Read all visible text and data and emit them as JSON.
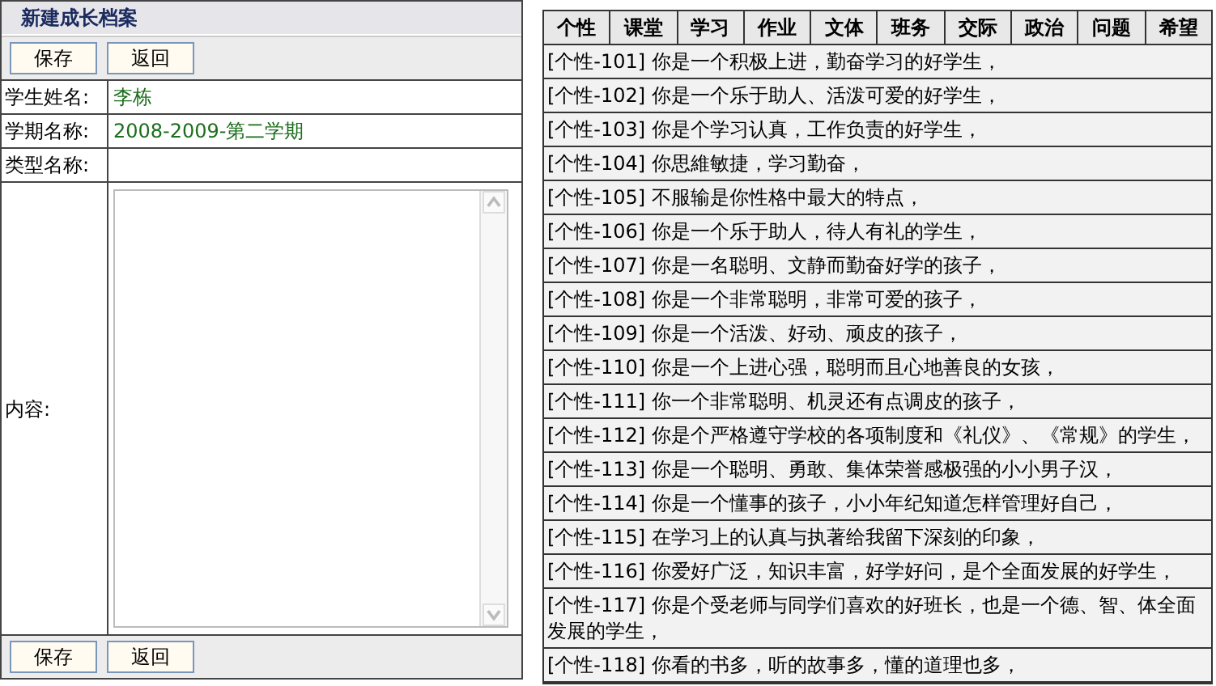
{
  "form": {
    "title": "新建成长档案",
    "top_buttons": [
      "保存",
      "返回"
    ],
    "fields": [
      {
        "label": "学生姓名:",
        "value": "李栋"
      },
      {
        "label": "学期名称:",
        "value": "2008-2009-第二学期"
      },
      {
        "label": "类型名称:"
      }
    ],
    "content_label": "内容:",
    "bottom_buttons": [
      "保存",
      "返回"
    ]
  },
  "tabs": [
    {
      "label": "个性"
    },
    {
      "label": "课堂"
    },
    {
      "label": "学习"
    },
    {
      "label": "作业"
    },
    {
      "label": "文体"
    },
    {
      "label": "班务"
    },
    {
      "label": "交际"
    },
    {
      "label": "政治"
    },
    {
      "label": "问题"
    },
    {
      "label": "希望"
    }
  ],
  "comments": [
    "[个性-101] 你是一个积极上进，勤奋学习的好学生，",
    "[个性-102] 你是一个乐于助人、活泼可爱的好学生，",
    "[个性-103] 你是个学习认真，工作负责的好学生，",
    "[个性-104] 你思維敏捷，学习勤奋，",
    "[个性-105] 不服输是你性格中最大的特点，",
    "[个性-106] 你是一个乐于助人，待人有礼的学生，",
    "[个性-107] 你是一名聪明、文静而勤奋好学的孩子，",
    "[个性-108] 你是一个非常聪明，非常可爱的孩子，",
    "[个性-109] 你是一个活泼、好动、顽皮的孩子，",
    "[个性-110] 你是一个上进心强，聪明而且心地善良的女孩，",
    "[个性-111] 你一个非常聪明、机灵还有点调皮的孩子，",
    "[个性-112] 你是个严格遵守学校的各项制度和《礼仪》、《常规》的学生，",
    "[个性-113] 你是一个聪明、勇敢、集体荣誉感极强的小小男子汉，",
    "[个性-114] 你是一个懂事的孩子，小小年纪知道怎样管理好自己，",
    "[个性-115] 在学习上的认真与执著给我留下深刻的印象，",
    "[个性-116] 你爱好广泛，知识丰富，好学好问，是个全面发展的好学生，",
    "[个性-117] 你是个受老师与同学们喜欢的好班长，也是一个德、智、体全面发展的学生，",
    "[个性-118] 你看的书多，听的故事多，懂的道理也多，"
  ]
}
